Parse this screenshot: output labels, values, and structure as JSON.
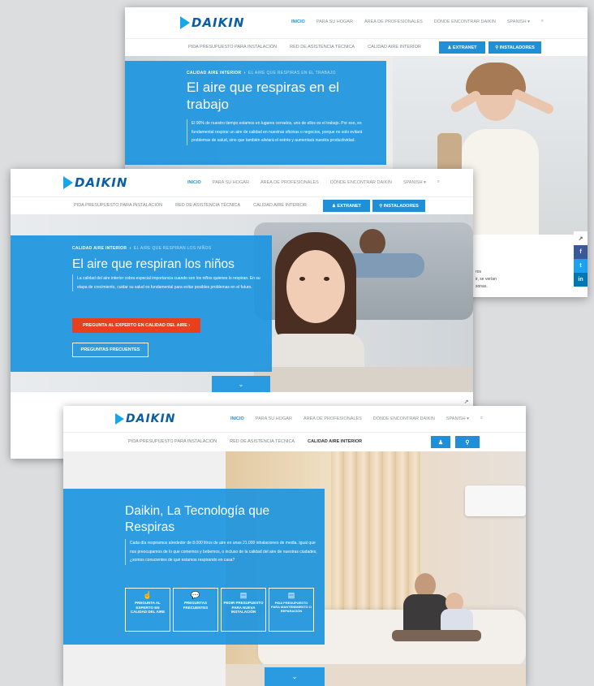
{
  "nav": {
    "brand": "DAIKIN",
    "items": [
      "INICIO",
      "PARA SU HOGAR",
      "ÁREA DE PROFESIONALES",
      "DÓNDE ENCONTRAR DAIKIN",
      "SPANISH ▾"
    ],
    "search_icon": "search-icon"
  },
  "subnav": {
    "items": [
      "PIDA PRESUPUESTO PARA INSTALACIÓN",
      "RED DE ASISTENCIA TÉCNICA",
      "CALIDAD AIRE INTERIOR"
    ],
    "extranet": "EXTRANET",
    "instaladores": "INSTALADORES"
  },
  "shot1": {
    "kicker": "CALIDAD AIRE INTERIOR",
    "kicker_sub": "EL AIRE QUE RESPIRAS EN EL TRABAJO",
    "title": "El aire que respiras en el trabajo",
    "body": "El 90% de nuestro tiempo estamos en lugares cerrados, uno de ellos es el trabajo. Por eso, es fundamental respirar un aire de calidad en nuestras oficinas o negocios, porque no solo evitará problemas de salud, sino que también aliviará el estrés y aumentará nuestra productividad.",
    "peek": [
      "ros",
      "ir, se verían",
      "sonas."
    ]
  },
  "shot2": {
    "kicker": "CALIDAD AIRE INTERIOR",
    "kicker_sub": "EL AIRE QUE RESPIRAN LOS NIÑOS",
    "title": "El aire que respiran los niños",
    "body": "La calidad del aire interior cobra especial importancia cuando son los niños quienes lo respiran. En su etapa de crecimiento, cuidar su salud es fundamental para evitar posibles problemas en el futuro.",
    "cta_primary": "PREGUNTA AL EXPERTO EN CALIDAD DEL AIRE  ›",
    "cta_secondary": "PREGUNTAS FRECUENTES"
  },
  "shot3": {
    "title": "Daikin, La Tecnología que Respiras",
    "body": "Cada día respiramos alrededor de 8.000 litros de aire en unas 21.000 inhalaciones de media. Igual que nos preocupamos de lo que comemos y bebemos, o incluso de la calidad del aire de nuestras ciudades, ¿somos conscientes de qué estamos respirando en casa?",
    "tiles": [
      {
        "icon": "pointer-icon",
        "label": "PREGUNTA AL EXPERTO EN CALIDAD DEL AIRE"
      },
      {
        "icon": "chat-icon",
        "label": "PREGUNTAS FRECUENTES"
      },
      {
        "icon": "document-icon",
        "label": "PEDIR PRESUPUESTO PARA NUEVA INSTALACIÓN"
      },
      {
        "icon": "document-icon",
        "label": "PIDA PRESUPUESTO PARA MANTENIMIENTO O REPARACIÓN"
      }
    ]
  },
  "share": {
    "icons": [
      "share-icon",
      "facebook-icon",
      "twitter-icon",
      "linkedin-icon"
    ],
    "labels": [
      "↗",
      "f",
      "t",
      "in"
    ]
  },
  "colors": {
    "brand": "#0a5ea8",
    "accent": "#1f8fd8",
    "cta": "#e8401c",
    "panel": "#2196de"
  }
}
